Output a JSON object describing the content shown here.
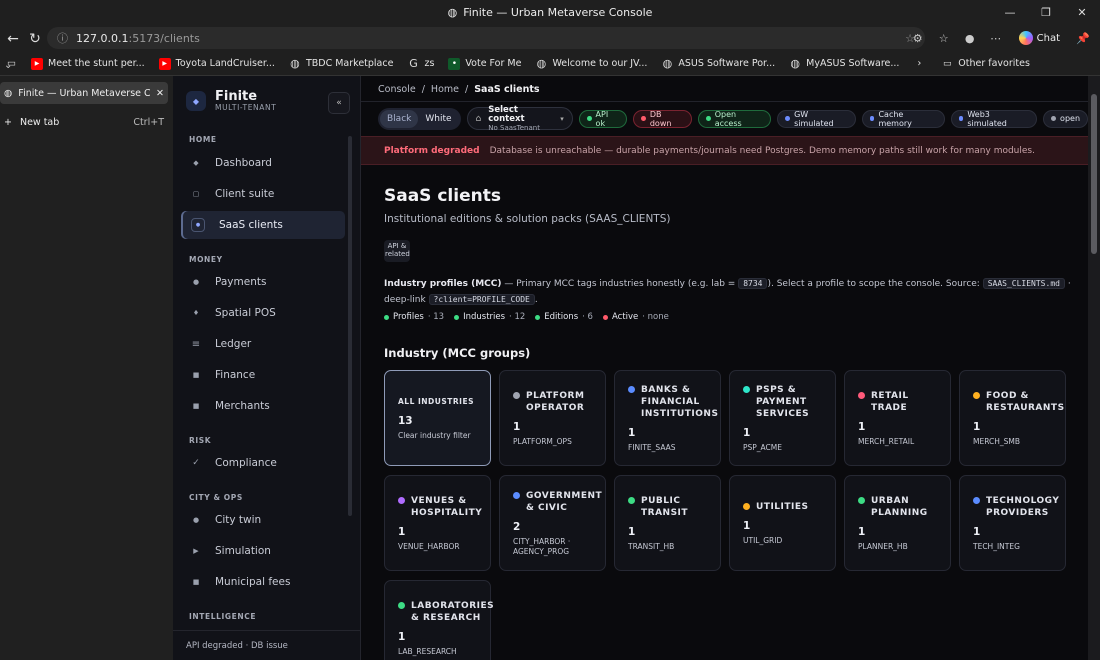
{
  "browser": {
    "window_title": "Finite — Urban Metaverse Console",
    "url_host": "127.0.0.1",
    "url_path": ":5173/clients",
    "chat_label": "Chat",
    "bookmarks": [
      {
        "label": "Meet the stunt per...",
        "icon": "youtube-icon"
      },
      {
        "label": "Toyota LandCruiser...",
        "icon": "youtube-icon"
      },
      {
        "label": "TBDC Marketplace",
        "icon": "globe-icon"
      },
      {
        "label": "zs",
        "icon": "google-icon"
      },
      {
        "label": "Vote For Me",
        "icon": "app-icon"
      },
      {
        "label": "Welcome to our JV...",
        "icon": "globe-icon"
      },
      {
        "label": "ASUS Software Por...",
        "icon": "globe-icon"
      },
      {
        "label": "MyASUS Software...",
        "icon": "globe-icon"
      }
    ],
    "other_favorites": "Other favorites",
    "tabs": {
      "active_title": "Finite — Urban Metaverse Console",
      "new_tab": "New tab",
      "new_tab_shortcut": "Ctrl+T"
    }
  },
  "sidebar": {
    "brand": "Finite",
    "brand_sub": "MULTI-TENANT",
    "collapse_label": "«",
    "sections": [
      {
        "title": "HOME",
        "items": [
          "Dashboard",
          "Client suite",
          "SaaS clients"
        ]
      },
      {
        "title": "MONEY",
        "items": [
          "Payments",
          "Spatial POS",
          "Ledger",
          "Finance",
          "Merchants"
        ]
      },
      {
        "title": "RISK",
        "items": [
          "Compliance"
        ]
      },
      {
        "title": "CITY & OPS",
        "items": [
          "City twin",
          "Simulation",
          "Municipal fees"
        ]
      },
      {
        "title": "INTELLIGENCE",
        "items": []
      }
    ],
    "footer": "API degraded · DB issue"
  },
  "main": {
    "breadcrumb": [
      "Console",
      "Home",
      "SaaS clients"
    ],
    "theme": {
      "black": "Black",
      "white": "White"
    },
    "context": {
      "title": "Select context",
      "sub": "No SaasTenant"
    },
    "pills": [
      {
        "label": "API ok",
        "kind": "green",
        "dot": "#3ddc84"
      },
      {
        "label": "DB down",
        "kind": "red",
        "dot": "#ff5a6a"
      },
      {
        "label": "Open access",
        "kind": "green",
        "dot": "#3ddc84"
      },
      {
        "label": "GW simulated",
        "kind": "neutral",
        "dot": "#6c8cff"
      },
      {
        "label": "Cache memory",
        "kind": "neutral",
        "dot": "#6c8cff"
      },
      {
        "label": "Web3 simulated",
        "kind": "neutral",
        "dot": "#6c8cff"
      },
      {
        "label": "open",
        "kind": "neutral",
        "dot": "#a0a4b0"
      }
    ],
    "banner": {
      "title": "Platform degraded",
      "text": "Database is unreachable — durable payments/journals need Postgres. Demo memory paths still work for many modules."
    },
    "title": "SaaS clients",
    "subtitle": "Institutional editions & solution packs (SAAS_CLIENTS)",
    "api_badge": "API & related",
    "profiles": {
      "label": "Industry profiles (MCC)",
      "text1": " — Primary MCC tags industries honestly (e.g. lab = ",
      "code1": "8734",
      "text2": "). Select a profile to scope the console. Source: ",
      "code2": "SAAS_CLIENTS.md",
      "text3": " · deep-link ",
      "code3": "?client=PROFILE_CODE",
      "text4": "."
    },
    "stats": [
      {
        "label": "Profiles",
        "value": "· 13",
        "color": "#3ddc84"
      },
      {
        "label": "Industries",
        "value": "· 12",
        "color": "#3ddc84"
      },
      {
        "label": "Editions",
        "value": "· 6",
        "color": "#3ddc84"
      },
      {
        "label": "Active",
        "value": "· none",
        "color": "#ff5a6a"
      }
    ],
    "section_title": "Industry (MCC groups)",
    "cards": [
      {
        "title": "ALL INDUSTRIES",
        "count": "13",
        "code": "Clear industry filter",
        "color": "",
        "selected": true
      },
      {
        "title": "PLATFORM OPERATOR",
        "count": "1",
        "code": "PLATFORM_OPS",
        "color": "#a0a4b0"
      },
      {
        "title": "BANKS & FINANCIAL INSTITUTIONS",
        "count": "1",
        "code": "FINITE_SAAS",
        "color": "#5b8cff"
      },
      {
        "title": "PSPS & PAYMENT SERVICES",
        "count": "1",
        "code": "PSP_ACME",
        "color": "#2ee6c9"
      },
      {
        "title": "RETAIL TRADE",
        "count": "1",
        "code": "MERCH_RETAIL",
        "color": "#ff5a7a"
      },
      {
        "title": "FOOD & RESTAURANTS",
        "count": "1",
        "code": "MERCH_SMB",
        "color": "#ffb020"
      },
      {
        "title": "VENUES & HOSPITALITY",
        "count": "1",
        "code": "VENUE_HARBOR",
        "color": "#b06cff"
      },
      {
        "title": "GOVERNMENT & CIVIC",
        "count": "2",
        "code": "CITY_HARBOR · AGENCY_PROG",
        "color": "#5b8cff"
      },
      {
        "title": "PUBLIC TRANSIT",
        "count": "1",
        "code": "TRANSIT_HB",
        "color": "#3ddc84"
      },
      {
        "title": "UTILITIES",
        "count": "1",
        "code": "UTIL_GRID",
        "color": "#ffb020"
      },
      {
        "title": "URBAN PLANNING",
        "count": "1",
        "code": "PLANNER_HB",
        "color": "#3ddc84"
      },
      {
        "title": "TECHNOLOGY PROVIDERS",
        "count": "1",
        "code": "TECH_INTEG",
        "color": "#5b8cff"
      },
      {
        "title": "LABORATORIES & RESEARCH",
        "count": "1",
        "code": "LAB_RESEARCH",
        "color": "#3ddc84"
      }
    ]
  }
}
